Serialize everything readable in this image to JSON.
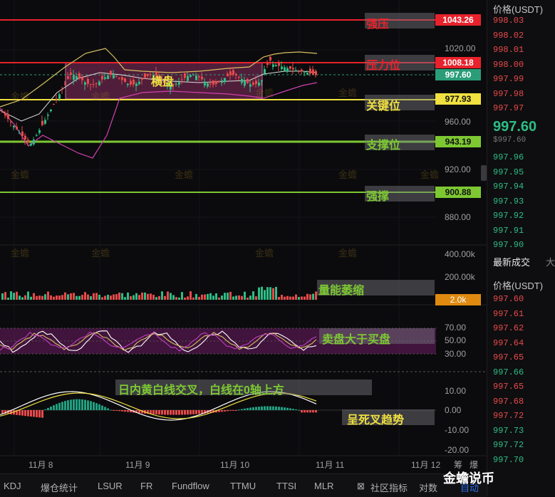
{
  "colors": {
    "bg": "#0b0b0d",
    "red_line": "#e8222c",
    "yellow_line": "#f0e040",
    "green_line": "#7dc832",
    "up": "#2ebd85",
    "down": "#e84a4a",
    "bollinger_upper": "#d8c060",
    "bollinger_lower": "#d040b0",
    "consolidation_box": "#8a3060"
  },
  "price_levels": [
    {
      "value": "1043.26",
      "annotation": "强压",
      "color": "#e8222c"
    },
    {
      "value": "1008.18",
      "annotation": "压力位",
      "color": "#e8222c"
    },
    {
      "value": "997.60",
      "annotation": "",
      "color": "#2a9d78"
    },
    {
      "value": "977.93",
      "annotation": "关键位",
      "color": "#f0e040"
    },
    {
      "value": "943.19",
      "annotation": "支撑位",
      "color": "#7dc832"
    },
    {
      "value": "900.88",
      "annotation": "强撑",
      "color": "#7dc832"
    }
  ],
  "price_axis": [
    "1020.00",
    "960.00",
    "920.00",
    "880.00"
  ],
  "consolidation_label": "横盘",
  "volume": {
    "axis": [
      "400.00k",
      "200.00k"
    ],
    "current": "2.0k",
    "annotation": "量能萎缩"
  },
  "oscillator": {
    "axis": [
      "70.00",
      "50.00",
      "30.00"
    ],
    "annotation": "卖盘大于买盘"
  },
  "macd": {
    "axis": [
      "10.00",
      "0.00",
      "-10.00",
      "-20.00"
    ],
    "annotation_top": "日内黄白线交叉，白线在0轴上方",
    "annotation_bottom": "呈死叉趋势"
  },
  "dates": [
    "11月 8",
    "11月 9",
    "11月 10",
    "11月 11",
    "11月 12"
  ],
  "watermark_text": "金蟾",
  "order_book": {
    "price_header": "价格(USDT)",
    "asks": [
      "998.03",
      "998.02",
      "998.01",
      "998.00",
      "997.99",
      "997.98",
      "997.97"
    ],
    "last_price": "997.60",
    "last_price_sub": "$997.60",
    "bids": [
      "997.96",
      "997.95",
      "997.94",
      "997.93",
      "997.92",
      "997.91",
      "997.90"
    ]
  },
  "trades": {
    "tab_label": "最新成交",
    "tab_label_2": "大",
    "price_header": "价格(USDT)",
    "rows": [
      {
        "price": "997.60",
        "side": "sell"
      },
      {
        "price": "997.61",
        "side": "sell"
      },
      {
        "price": "997.62",
        "side": "sell"
      },
      {
        "price": "997.64",
        "side": "sell"
      },
      {
        "price": "997.65",
        "side": "sell"
      },
      {
        "price": "997.66",
        "side": "buy"
      },
      {
        "price": "997.65",
        "side": "sell"
      },
      {
        "price": "997.68",
        "side": "sell"
      },
      {
        "price": "997.72",
        "side": "sell"
      },
      {
        "price": "997.73",
        "side": "buy"
      },
      {
        "price": "997.72",
        "side": "buy"
      },
      {
        "price": "997.70",
        "side": "buy"
      }
    ]
  },
  "toolbar": {
    "items": [
      "KDJ",
      "爆仓统计",
      "LSUR",
      "FR",
      "Fundflow",
      "TTMU",
      "TTSI",
      "MLR"
    ],
    "indicators_label": "社区指标",
    "compare_label": "对数",
    "auto_label": "自动"
  },
  "brand": "金蟾说币",
  "extra_labels": {
    "fang": "筹",
    "bao": "爆"
  }
}
